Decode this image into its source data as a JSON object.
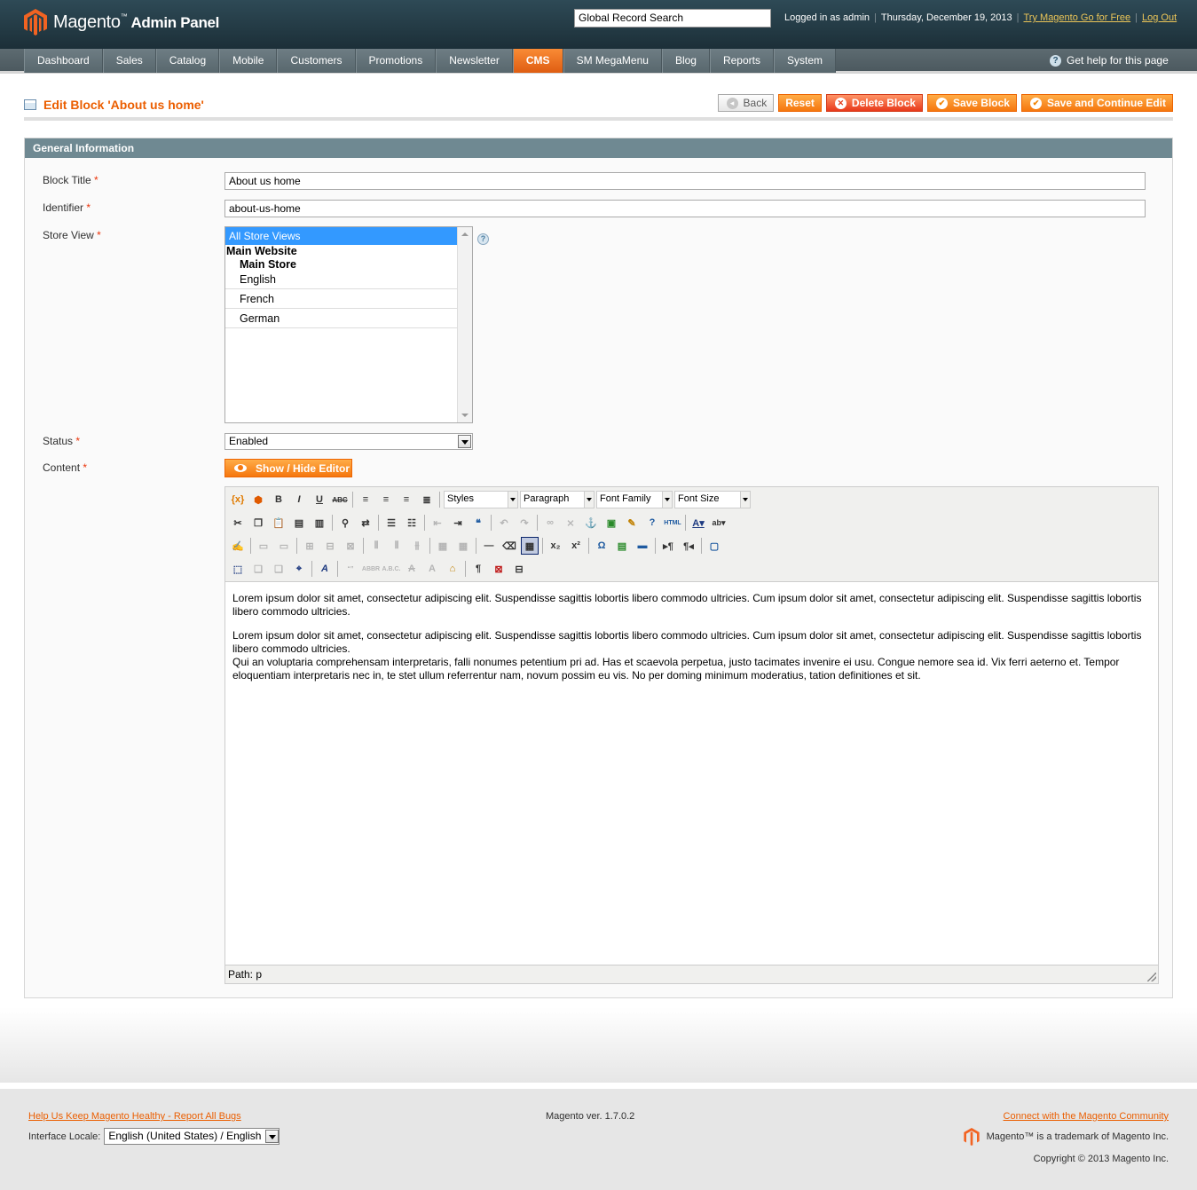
{
  "header": {
    "logo_text": "Magento",
    "logo_tm": "™",
    "logo_sub": "Admin Panel",
    "search_placeholder": "Global Record Search",
    "logged_in": "Logged in as admin",
    "date": "Thursday, December 19, 2013",
    "try_link": "Try Magento Go for Free",
    "logout": "Log Out"
  },
  "nav": {
    "items": [
      "Dashboard",
      "Sales",
      "Catalog",
      "Mobile",
      "Customers",
      "Promotions",
      "Newsletter",
      "CMS",
      "SM MegaMenu",
      "Blog",
      "Reports",
      "System"
    ],
    "active": "CMS",
    "help": "Get help for this page"
  },
  "page": {
    "title": "Edit Block 'About us home'",
    "buttons": {
      "back": "Back",
      "reset": "Reset",
      "delete": "Delete Block",
      "save": "Save Block",
      "save_continue": "Save and Continue Edit"
    }
  },
  "form": {
    "section_title": "General Information",
    "block_title_label": "Block Title",
    "block_title_value": "About us home",
    "identifier_label": "Identifier",
    "identifier_value": "about-us-home",
    "store_view_label": "Store View",
    "store_views": {
      "selected": "All Store Views",
      "website": "Main Website",
      "store": "Main Store",
      "views": [
        "English",
        "French",
        "German"
      ]
    },
    "status_label": "Status",
    "status_value": "Enabled",
    "content_label": "Content",
    "required_mark": "*",
    "show_hide": "Show / Hide Editor"
  },
  "editor": {
    "styles": "Styles",
    "paragraph": "Paragraph",
    "font_family": "Font Family",
    "font_size": "Font Size",
    "paragraphs": [
      "Lorem ipsum dolor sit amet, consectetur adipiscing elit. Suspendisse sagittis lobortis libero commodo ultricies. Cum ipsum dolor sit amet, consectetur adipiscing elit. Suspendisse sagittis lobortis libero commodo ultricies.",
      "Lorem ipsum dolor sit amet, consectetur adipiscing elit. Suspendisse sagittis lobortis libero commodo ultricies. Cum ipsum dolor sit amet, consectetur adipiscing elit. Suspendisse sagittis lobortis libero commodo ultricies.",
      "Qui an voluptaria comprehensam interpretaris, falli nonumes petentium pri ad. Has et scaevola perpetua, justo tacimates invenire ei usu. Congue nemore sea id. Vix ferri aeterno et. Tempor eloquentiam interpretaris nec in, te stet ullum referrentur nam, novum possim eu vis. No per doming minimum moderatius, tation definitiones et sit."
    ],
    "path": "Path: p"
  },
  "footer": {
    "bugs_link": "Help Us Keep Magento Healthy - Report All Bugs",
    "locale_label": "Interface Locale:",
    "locale_value": "English (United States) / English",
    "version": "Magento ver. 1.7.0.2",
    "community_link": "Connect with the Magento Community",
    "trademark": "Magento™ is a trademark of Magento Inc.",
    "copyright": "Copyright © 2013 Magento Inc."
  },
  "colors": {
    "accent": "#eb5e00",
    "header_bg": "#1f333d",
    "section_head": "#6f8992"
  }
}
